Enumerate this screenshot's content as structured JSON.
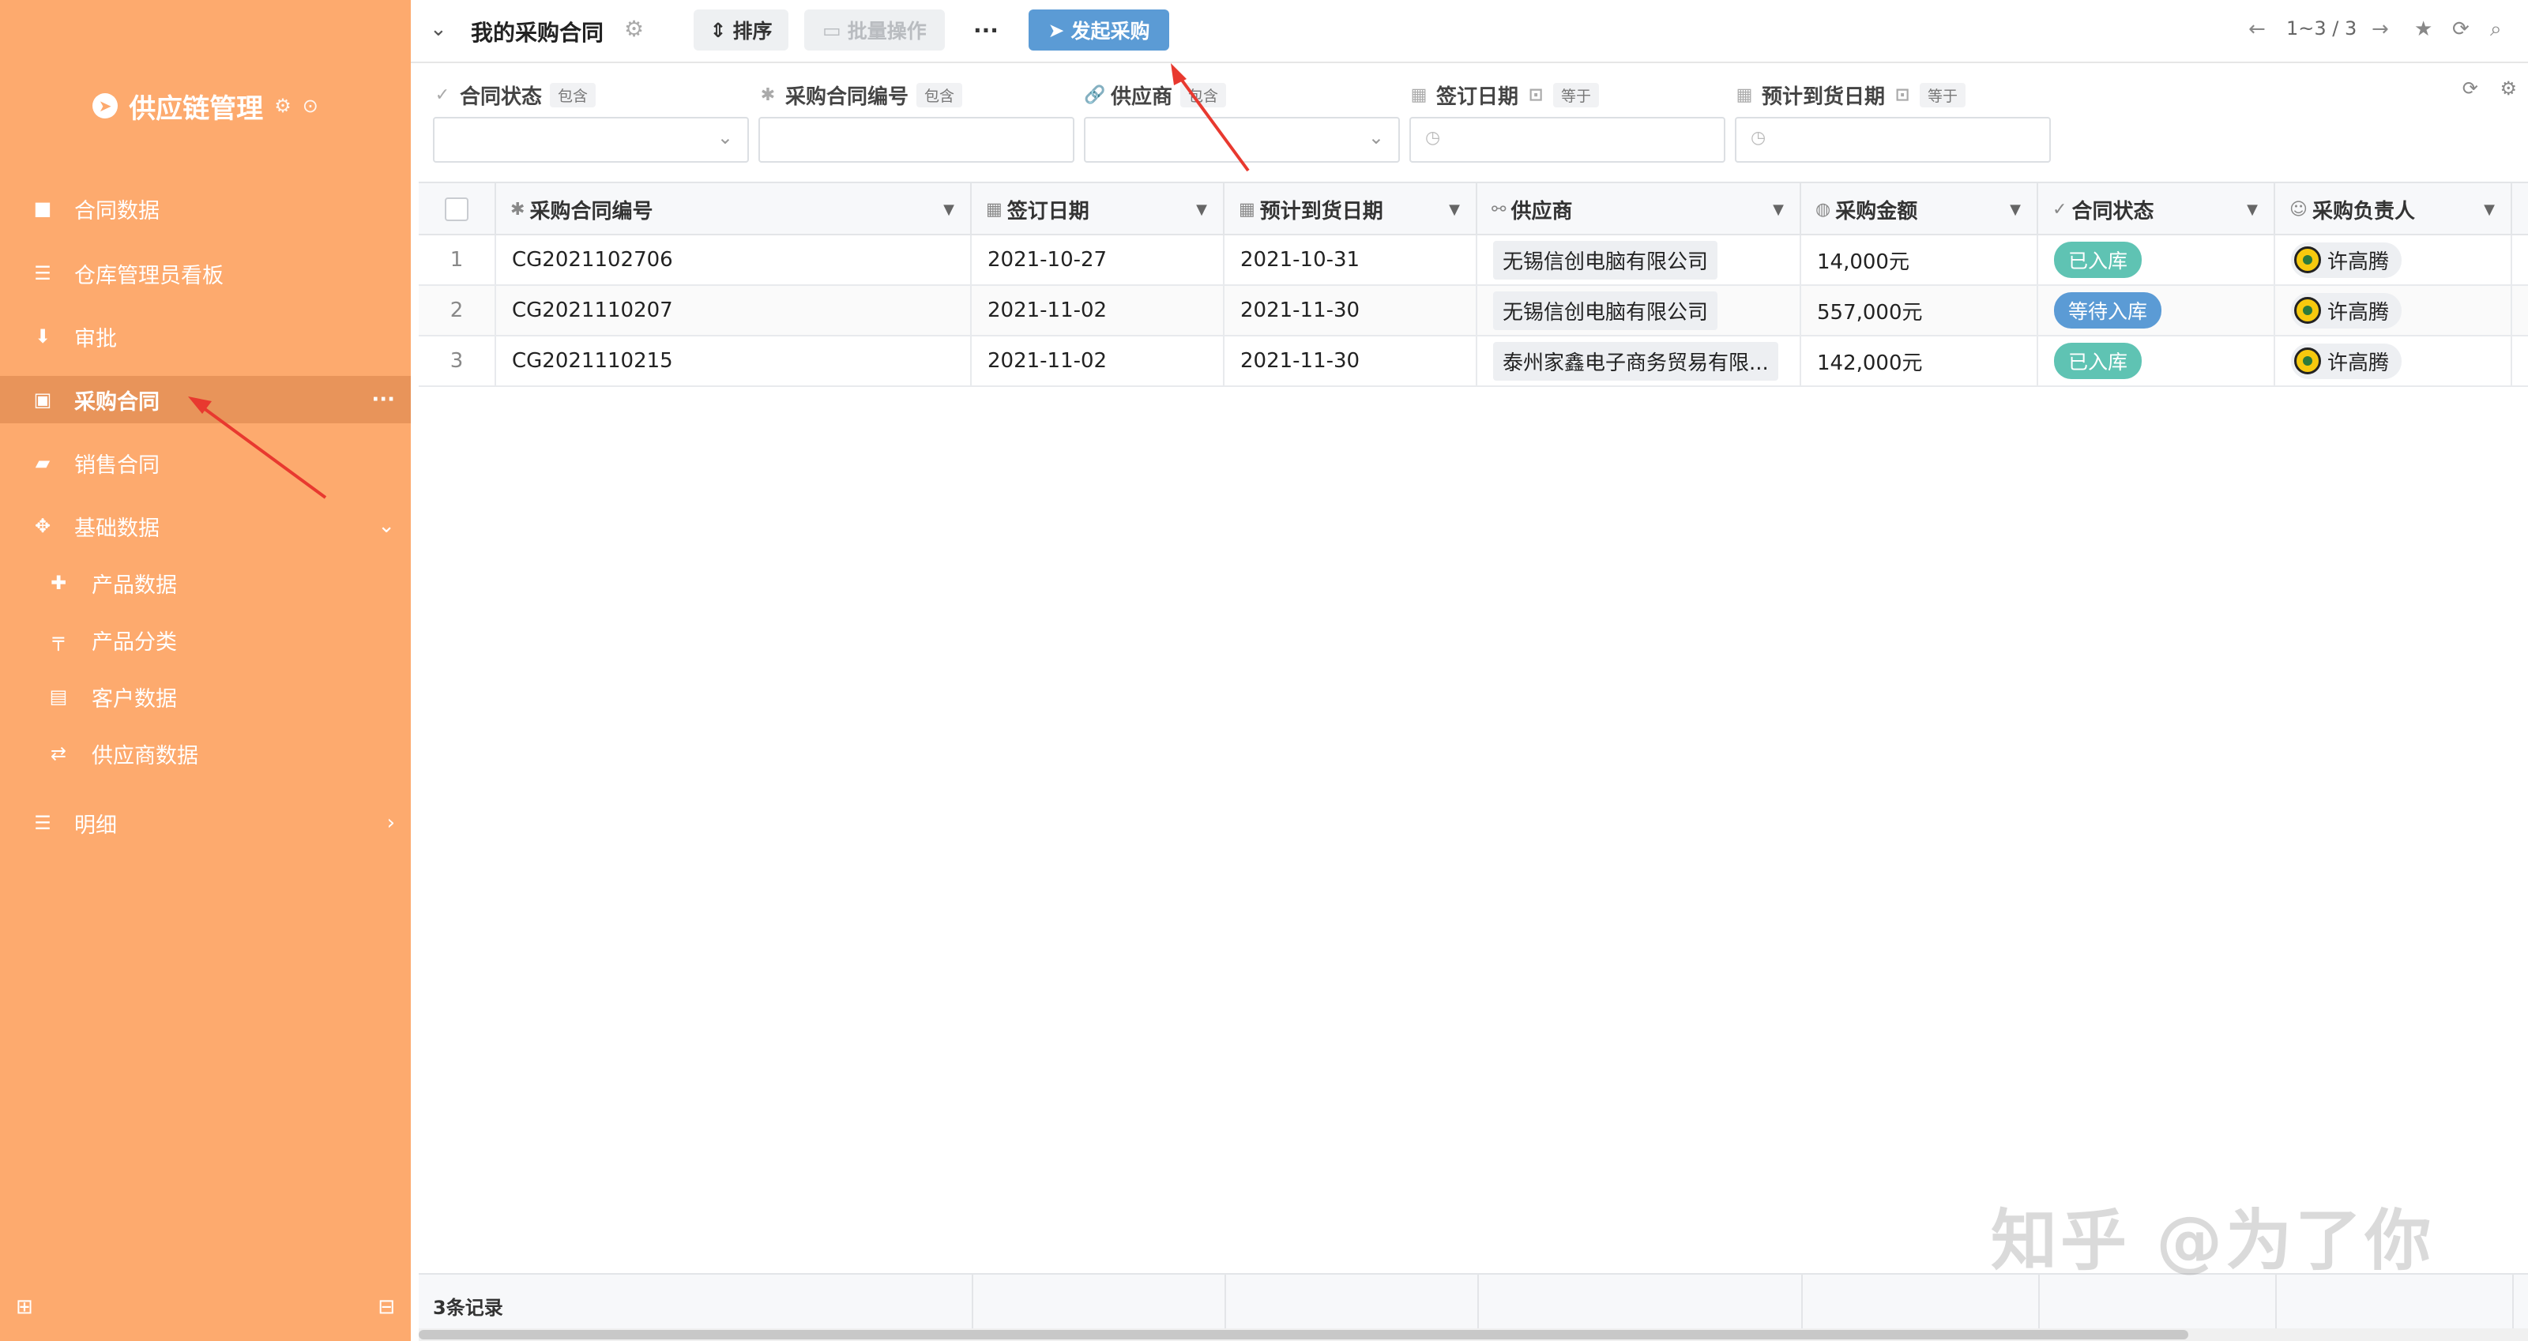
{
  "sidebar": {
    "brand": "供应链管理",
    "items": [
      {
        "label": "合同数据",
        "icon": "briefcase-icon"
      },
      {
        "label": "仓库管理员看板",
        "icon": "list-icon"
      },
      {
        "label": "审批",
        "icon": "stamp-icon"
      },
      {
        "label": "采购合同",
        "icon": "basket-icon",
        "active": true
      },
      {
        "label": "销售合同",
        "icon": "book-icon"
      },
      {
        "label": "基础数据",
        "icon": "gear-icon",
        "expanded": true
      },
      {
        "label": "产品数据",
        "icon": "puzzle-icon"
      },
      {
        "label": "产品分类",
        "icon": "signpost-icon"
      },
      {
        "label": "客户数据",
        "icon": "id-card-icon"
      },
      {
        "label": "供应商数据",
        "icon": "exchange-icon"
      },
      {
        "label": "明细",
        "icon": "list-icon"
      }
    ]
  },
  "toolbar": {
    "title": "我的采购合同",
    "sort_label": "排序",
    "batch_label": "批量操作",
    "more_label": "···",
    "purchase_label": "发起采购",
    "pager": "1~3 / 3"
  },
  "filters": [
    {
      "label": "合同状态",
      "op": "包含",
      "kind": "select"
    },
    {
      "label": "采购合同编号",
      "op": "包含",
      "kind": "text"
    },
    {
      "label": "供应商",
      "op": "包含",
      "kind": "select"
    },
    {
      "label": "签订日期",
      "op": "等于",
      "kind": "date"
    },
    {
      "label": "预计到货日期",
      "op": "等于",
      "kind": "date"
    }
  ],
  "table": {
    "columns": [
      "采购合同编号",
      "签订日期",
      "预计到货日期",
      "供应商",
      "采购金额",
      "合同状态",
      "采购负责人"
    ],
    "rows": [
      {
        "idx": "1",
        "no": "CG2021102706",
        "sign": "2021-10-27",
        "arrive": "2021-10-31",
        "supplier": "无锡信创电脑有限公司",
        "amount": "14,000元",
        "status": "已入库",
        "owner": "许高腾"
      },
      {
        "idx": "2",
        "no": "CG2021110207",
        "sign": "2021-11-02",
        "arrive": "2021-11-30",
        "supplier": "无锡信创电脑有限公司",
        "amount": "557,000元",
        "status": "等待入库",
        "owner": "许高腾"
      },
      {
        "idx": "3",
        "no": "CG2021110215",
        "sign": "2021-11-02",
        "arrive": "2021-11-30",
        "supplier": "泰州家鑫电子商务贸易有限...",
        "amount": "142,000元",
        "status": "已入库",
        "owner": "许高腾"
      }
    ],
    "footer": "3条记录"
  },
  "watermark": "知乎 @为了你",
  "colors": {
    "sidebar": "#fdaa6e",
    "accent": "#5b9bd5",
    "status_in": "#5fc3b3",
    "status_wait": "#5b9bd5",
    "annotation": "#e8392f"
  }
}
